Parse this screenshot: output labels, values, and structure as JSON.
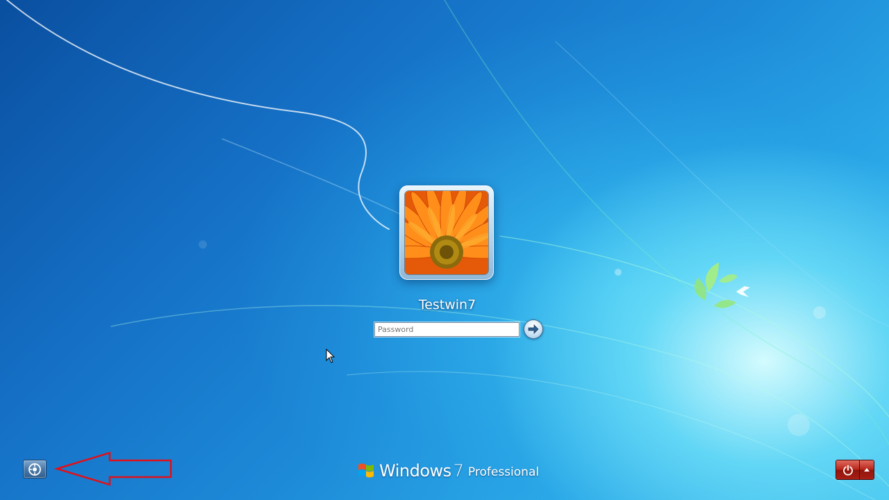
{
  "login": {
    "username": "Testwin7",
    "password_placeholder": "Password",
    "password_value": ""
  },
  "branding": {
    "name": "Windows",
    "version": "7",
    "edition": "Professional"
  },
  "icons": {
    "avatar": "flower-avatar-icon",
    "submit": "arrow-right-icon",
    "ease_of_access": "ease-of-access-icon",
    "shutdown": "power-icon",
    "shutdown_options": "triangle-up-icon",
    "annotation": "red-arrow-annotation",
    "windows_logo": "windows-logo-icon",
    "cursor": "mouse-cursor-icon"
  },
  "colors": {
    "background_dark": "#0a4fa0",
    "background_light": "#3fc0ee",
    "shutdown_red": "#b8281c",
    "annotation_red": "#e0101a"
  }
}
